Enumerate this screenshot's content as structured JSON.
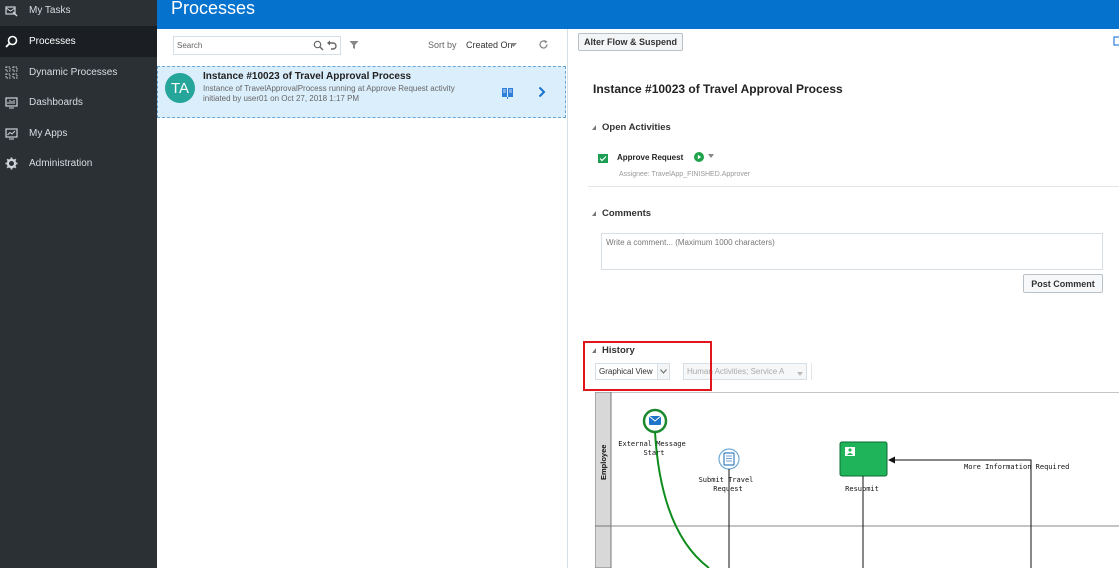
{
  "sidebar": {
    "items": [
      {
        "label": "My Tasks",
        "icon": "inbox-icon"
      },
      {
        "label": "Processes",
        "icon": "search-icon"
      },
      {
        "label": "Dynamic Processes",
        "icon": "dynamic-process-icon"
      },
      {
        "label": "Dashboards",
        "icon": "dashboard-icon"
      },
      {
        "label": "My Apps",
        "icon": "apps-icon"
      },
      {
        "label": "Administration",
        "icon": "gear-icon"
      }
    ]
  },
  "header": {
    "title": "Processes"
  },
  "list": {
    "search_placeholder": "Search",
    "sort_label": "Sort by",
    "sort_value": "Created On",
    "instance": {
      "avatar": "TA",
      "title": "Instance #10023 of Travel Approval Process",
      "line1": "Instance of TravelApprovalProcess running at Approve Request activity",
      "line2": "initiated by user01 on Oct 27, 2018 1:17 PM"
    }
  },
  "detail": {
    "alter_button": "Alter Flow & Suspend",
    "title": "Instance #10023 of Travel Approval Process",
    "open_activities": {
      "heading": "Open Activities",
      "activity": "Approve Request",
      "assignee": "Assignee: TravelApp_FINISHED.Approver"
    },
    "comments": {
      "heading": "Comments",
      "placeholder": "Write a comment... (Maximum 1000 characters)",
      "post_button": "Post Comment"
    },
    "history": {
      "heading": "History",
      "view_select": "Graphical View",
      "filter_select": "Human Activities; Service A"
    },
    "diagram": {
      "lane": "Employee",
      "start_label_1": "External Message",
      "start_label_2": "Start",
      "submit_label_1": "Submit Travel",
      "submit_label_2": "Request",
      "resubmit_label": "Resubmit",
      "more_info_label": "More Information Required"
    }
  },
  "colors": {
    "accent": "#0572ce",
    "sidebar": "#2b3035",
    "highlight": "#e0161b",
    "task_green": "#1fb45a"
  }
}
